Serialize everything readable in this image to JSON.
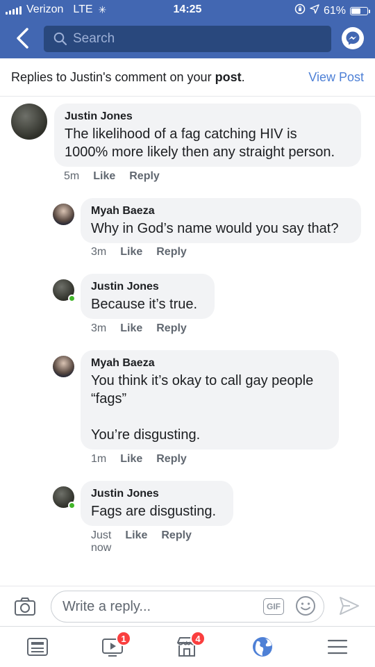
{
  "status_bar": {
    "carrier": "Verizon",
    "network": "LTE",
    "time": "14:25",
    "battery": "61%",
    "battery_level": 0.61
  },
  "header": {
    "search_placeholder": "Search"
  },
  "context": {
    "prefix": "Replies to Justin's comment on your ",
    "bold": "post",
    "suffix": ".",
    "view_post": "View Post"
  },
  "labels": {
    "like": "Like",
    "reply": "Reply"
  },
  "comments": [
    {
      "author": "Justin Jones",
      "text": "The likelihood of a fag catching HIV is\n1000% more likely then any straight person.",
      "time": "5m",
      "online": false
    },
    {
      "author": "Myah Baeza",
      "text": "Why in God’s name would you say that?",
      "time": "3m",
      "online": false
    },
    {
      "author": "Justin Jones",
      "text": "Because it’s true.",
      "time": "3m",
      "online": true
    },
    {
      "author": "Myah Baeza",
      "text": "You think it’s okay to call gay people\n“fags”\n\nYou’re disgusting.",
      "time": "1m",
      "online": false
    },
    {
      "author": "Justin Jones",
      "text": "Fags are disgusting.",
      "time": "Just now",
      "online": true
    }
  ],
  "composer": {
    "placeholder": "Write a reply...",
    "gif_label": "GIF"
  },
  "tabbar": {
    "video_badge": "1",
    "marketplace_badge": "4"
  },
  "colors": {
    "brand_blue": "#4267b2",
    "link_blue": "#4e80d6",
    "badge_red": "#fa3e3e",
    "online_green": "#42b72a"
  }
}
